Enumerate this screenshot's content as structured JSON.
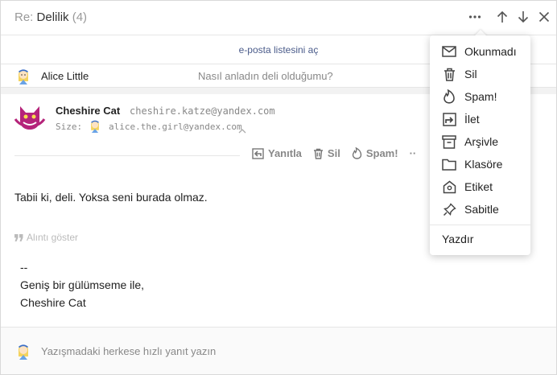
{
  "header": {
    "prefix": "Re: ",
    "title": "Delilik",
    "count": "(4)"
  },
  "open_list_label": "e-posta listesini aç",
  "thread_item": {
    "name": "Alice Little",
    "snippet": "Nasıl anladın deli olduğumu?"
  },
  "message": {
    "sender_name": "Cheshire Cat",
    "sender_email": "cheshire.katze@yandex.com",
    "to_label": "Size:",
    "to_email": "alice.the.girl@yandex.com",
    "actions": {
      "reply": "Yanıtla",
      "delete": "Sil",
      "spam": "Spam!",
      "more": "··"
    },
    "body": "Tabii ki, deli. Yoksa seni burada olmaz.",
    "quote_toggle": "Alıntı göster",
    "signature": [
      "--",
      "Geniş bir gülümseme ile,",
      "Cheshire Cat"
    ]
  },
  "quick_reply_placeholder": "Yazışmadaki herkese hızlı yanıt yazın",
  "menu": {
    "items": [
      {
        "label": "Okunmadı",
        "icon": "envelope-icon"
      },
      {
        "label": "Sil",
        "icon": "trash-icon"
      },
      {
        "label": "Spam!",
        "icon": "flame-icon"
      },
      {
        "label": "İlet",
        "icon": "forward-icon"
      },
      {
        "label": "Arşivle",
        "icon": "archive-icon"
      },
      {
        "label": "Klasöre",
        "icon": "folder-icon"
      },
      {
        "label": "Etiket",
        "icon": "tag-icon"
      },
      {
        "label": "Sabitle",
        "icon": "pin-icon"
      }
    ],
    "print_label": "Yazdır"
  },
  "colors": {
    "accent": "#4a5b8a",
    "muted": "#888888",
    "cat": "#b5247a"
  }
}
